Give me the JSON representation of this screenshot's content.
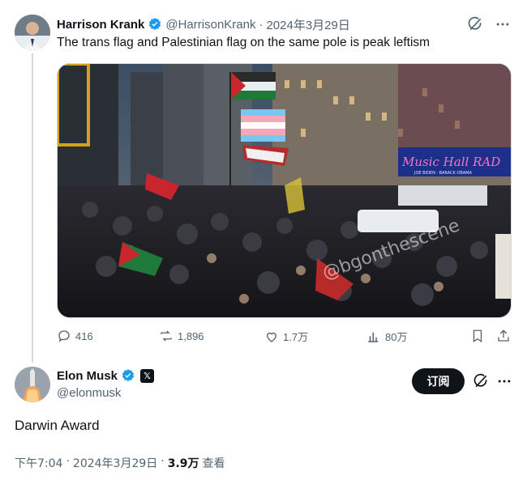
{
  "tweet1": {
    "name": "Harrison Krank",
    "handle": "@HarrisonKrank",
    "date": "2024年3月29日",
    "text": "The trans flag and Palestinian flag on the same pole is peak leftism",
    "media": {
      "sign_text": "Music Hall RAD",
      "sign_subtext": "JOE BIDEN · BARACK OBAMA",
      "watermark": "@bgonthescene"
    },
    "stats": {
      "replies": "416",
      "reposts": "1,896",
      "likes": "1.7万",
      "views": "80万"
    }
  },
  "tweet2": {
    "name": "Elon Musk",
    "x_badge": "𝕏",
    "handle": "@elonmusk",
    "subscribe_label": "订阅",
    "text": "Darwin Award",
    "time": "下午7:04",
    "date": "2024年3月29日",
    "views_count": "3.9万",
    "views_label": "查看"
  },
  "icons": {
    "verified_color": "#1d9bf0",
    "grok": "grok-icon",
    "more": "more-icon"
  }
}
